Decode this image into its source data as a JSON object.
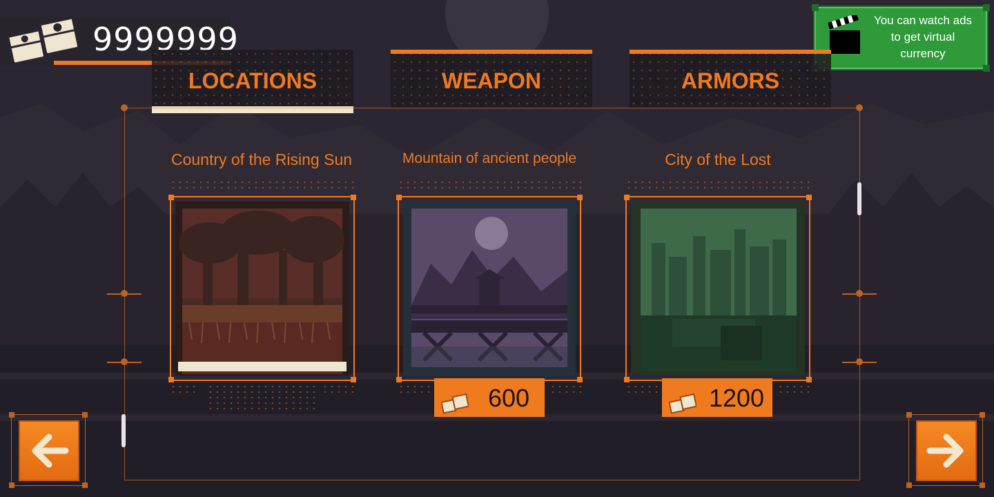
{
  "currency": {
    "amount": "9999999",
    "icon": "money-stack-icon"
  },
  "ads": {
    "text_line1": "You can watch ads",
    "text_line2": "to get virtual",
    "text_line3": "currency",
    "icon": "clapperboard-icon"
  },
  "tabs": [
    {
      "label": "LOCATIONS",
      "active": true
    },
    {
      "label": "WEAPON",
      "active": false
    },
    {
      "label": "ARMORS",
      "active": false
    }
  ],
  "locations": [
    {
      "title": "Country of the Rising Sun",
      "selected": true,
      "price": null,
      "theme": "forest"
    },
    {
      "title": "Mountain of ancient people",
      "selected": false,
      "price": "600",
      "theme": "temple"
    },
    {
      "title": "City of the Lost",
      "selected": false,
      "price": "1200",
      "theme": "city"
    }
  ],
  "navigation": {
    "prev_icon": "arrow-left-icon",
    "next_icon": "arrow-right-icon"
  },
  "colors": {
    "accent": "#f07a1e",
    "background": "#2a2530",
    "ads_green": "#2e9a3a",
    "cream": "#efe6cf"
  }
}
